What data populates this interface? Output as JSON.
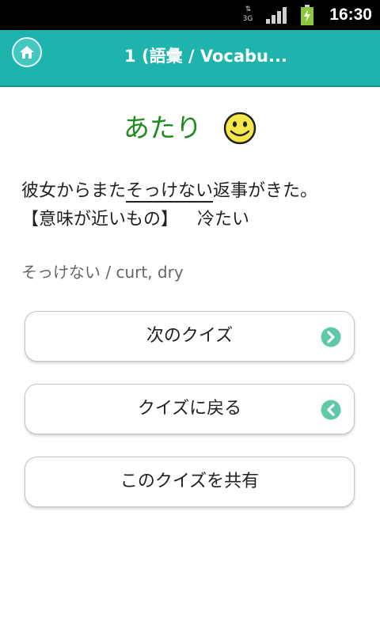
{
  "status_bar": {
    "network_type": "3G",
    "time": "16:30"
  },
  "header": {
    "title": "1 (語彙 / Vocabu...",
    "home_icon": "home-icon",
    "colors": {
      "background": "#1fb3ad"
    }
  },
  "result": {
    "text": "あたり",
    "icon": "smiley-icon",
    "color": "#1e8b1e"
  },
  "question": {
    "before": "彼女からまた",
    "target": "そっけない",
    "after": "返事がきた。",
    "meaning_label": "【意味が近いもの】",
    "meaning_answer": "冷たい"
  },
  "translation": "そっけない / curt, dry",
  "buttons": {
    "next": {
      "label": "次のクイズ",
      "icon": "chevron-right-icon"
    },
    "back": {
      "label": "クイズに戻る",
      "icon": "chevron-left-icon"
    },
    "share": {
      "label": "このクイズを共有"
    }
  }
}
